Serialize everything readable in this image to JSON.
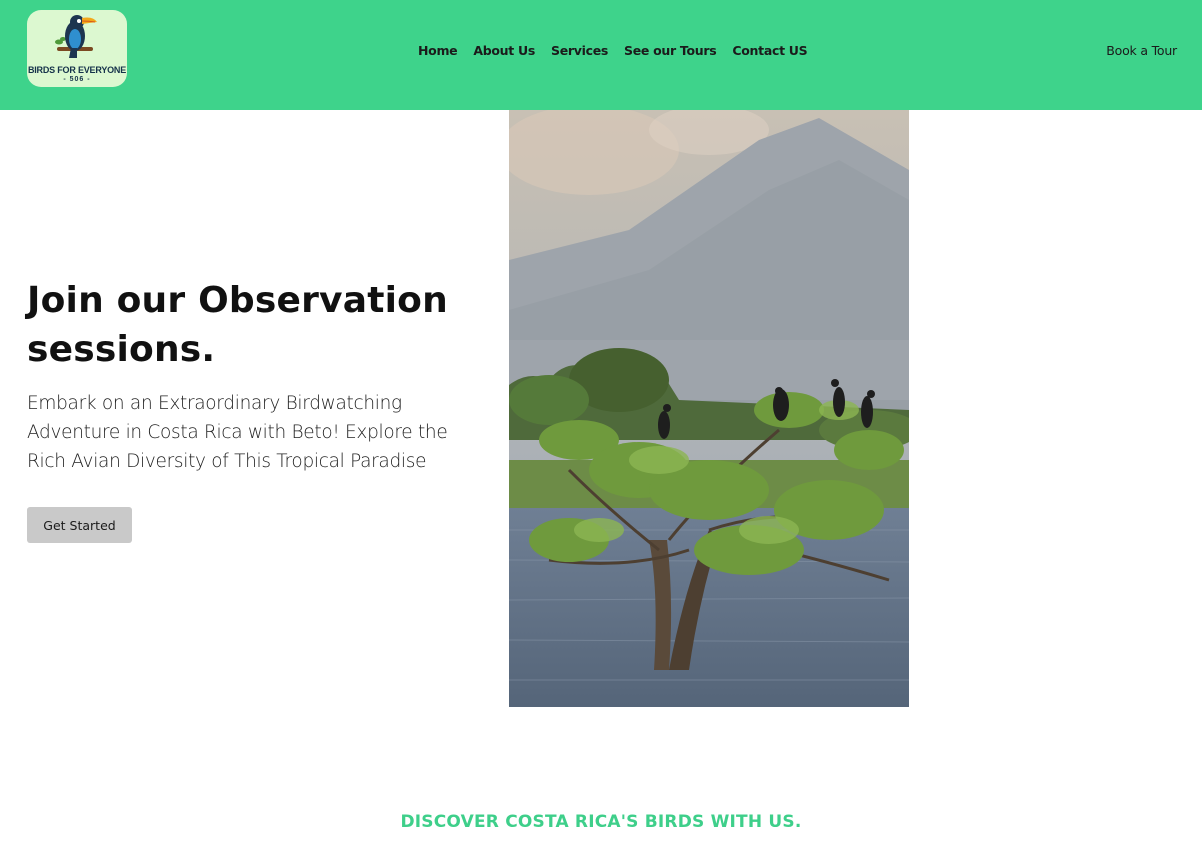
{
  "brand": {
    "name_line1": "BIRDS FOR EVERYONE",
    "name_line2": "- 506 -",
    "header_color": "#3ed38b",
    "logo_bg": "#dcf8d0"
  },
  "nav": {
    "items": [
      "Home",
      "About Us",
      "Services",
      "See our Tours",
      "Contact US"
    ],
    "cta": "Book a Tour"
  },
  "hero": {
    "title": "Join our Observation sessions.",
    "subtitle": "Embark on an Extraordinary Birdwatching Adventure in Costa Rica with Beto! Explore the Rich Avian Diversity of This Tropical Paradise",
    "button_label": "Get Started",
    "image_icon": "birds-in-tree-photo"
  },
  "section": {
    "heading": "DISCOVER COSTA RICA'S BIRDS WITH US.",
    "accent_color": "#3ecf8a"
  }
}
